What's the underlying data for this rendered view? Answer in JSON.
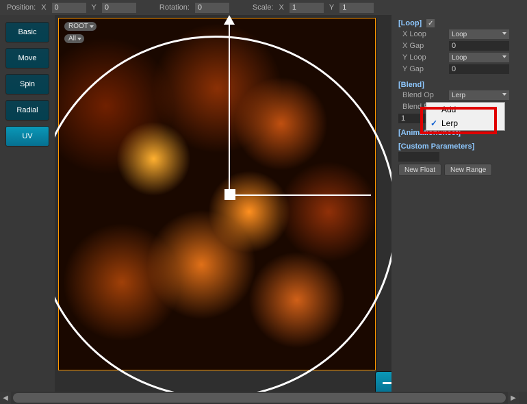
{
  "topbar": {
    "position_label": "Position:",
    "x_label": "X",
    "pos_x": "0",
    "y_label": "Y",
    "pos_y": "0",
    "rotation_label": "Rotation:",
    "rotation": "0",
    "scale_label": "Scale:",
    "scale_x": "1",
    "scale_y": "1"
  },
  "sidebar": {
    "items": [
      {
        "label": "Basic"
      },
      {
        "label": "Move"
      },
      {
        "label": "Spin"
      },
      {
        "label": "Radial"
      },
      {
        "label": "UV"
      }
    ]
  },
  "viewport": {
    "tag_root": "ROOT",
    "tag_all": "All"
  },
  "inspector": {
    "loop": {
      "title": "[Loop]",
      "checked": true,
      "x_loop_label": "X Loop",
      "x_loop_value": "Loop",
      "x_gap_label": "X Gap",
      "x_gap_value": "0",
      "y_loop_label": "Y Loop",
      "y_loop_value": "Loop",
      "y_gap_label": "Y Gap",
      "y_gap_value": "0"
    },
    "blend": {
      "title": "[Blend]",
      "op_label": "Blend Op",
      "op_value": "Lerp",
      "factor_label": "Blend Factor",
      "factor_value": "1",
      "options": [
        "Add",
        "Lerp"
      ],
      "selected_option": "Lerp"
    },
    "anim_sheet_title": "[AnimationSheet]",
    "custom_params": {
      "title": "[Custom Parameters]",
      "new_float": "New Float",
      "new_range": "New Range"
    }
  }
}
